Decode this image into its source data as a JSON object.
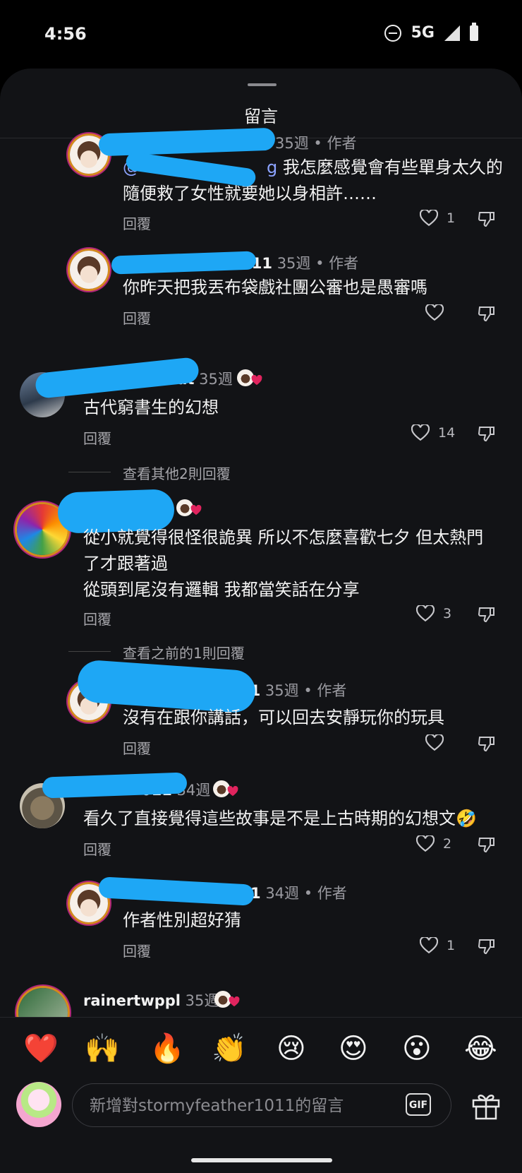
{
  "status_bar": {
    "time": "4:56",
    "network": "5G"
  },
  "sheet": {
    "title": "留言"
  },
  "comments": [
    {
      "time": "35週",
      "badge": "作者",
      "mention": "@",
      "mention_tail": "g",
      "text": "我怎麼感覺會有些單身太久的",
      "text2": "隨便救了女性就要她以身相許……",
      "reply": "回覆",
      "likes": "1"
    },
    {
      "user_tail": "her1011",
      "time": "35週",
      "badge": "作者",
      "text": "你昨天把我丟布袋戲社團公審也是愚審嗎",
      "reply": "回覆",
      "likes": ""
    },
    {
      "user_head": "i",
      "user_tail": "at",
      "time": "35週",
      "text": "古代窮書生的幻想",
      "reply": "回覆",
      "likes": "14"
    },
    {
      "text": "從小就覺得很怪很詭異 所以不怎麼喜歡七夕 但太熱門",
      "text2": "了才跟著過",
      "text3": "從頭到尾沒有邏輯 我都當笑話在分享",
      "reply": "回覆",
      "likes": "3"
    },
    {
      "user_tail": "11",
      "time": "35週",
      "badge": "作者",
      "text": "沒有在跟你講話，可以回去安靜玩你的玩具",
      "reply": "回覆",
      "likes": ""
    },
    {
      "user_tail": "011",
      "time": "34週",
      "text": "看久了直接覺得這些故事是不是上古時期的幻想文🤣",
      "reply": "回覆",
      "likes": "2"
    },
    {
      "user_tail": "1",
      "time": "34週",
      "badge": "作者",
      "text": "作者性別超好猜",
      "reply": "回覆",
      "likes": "1"
    },
    {
      "user": "rainertwppl",
      "time": "35週"
    }
  ],
  "view_more": [
    "查看其他2則回覆",
    "查看之前的1則回覆"
  ],
  "reactions": [
    "❤️",
    "🙌",
    "🔥",
    "👏",
    "😢",
    "😍",
    "😮",
    "😂"
  ],
  "input": {
    "placeholder": "新增對stormyfeather1011的留言",
    "gif_label": "GIF"
  },
  "colors": {
    "accent_mention": "#8ca3ff",
    "redaction": "#1ea7f5",
    "heart": "#e0245e"
  }
}
